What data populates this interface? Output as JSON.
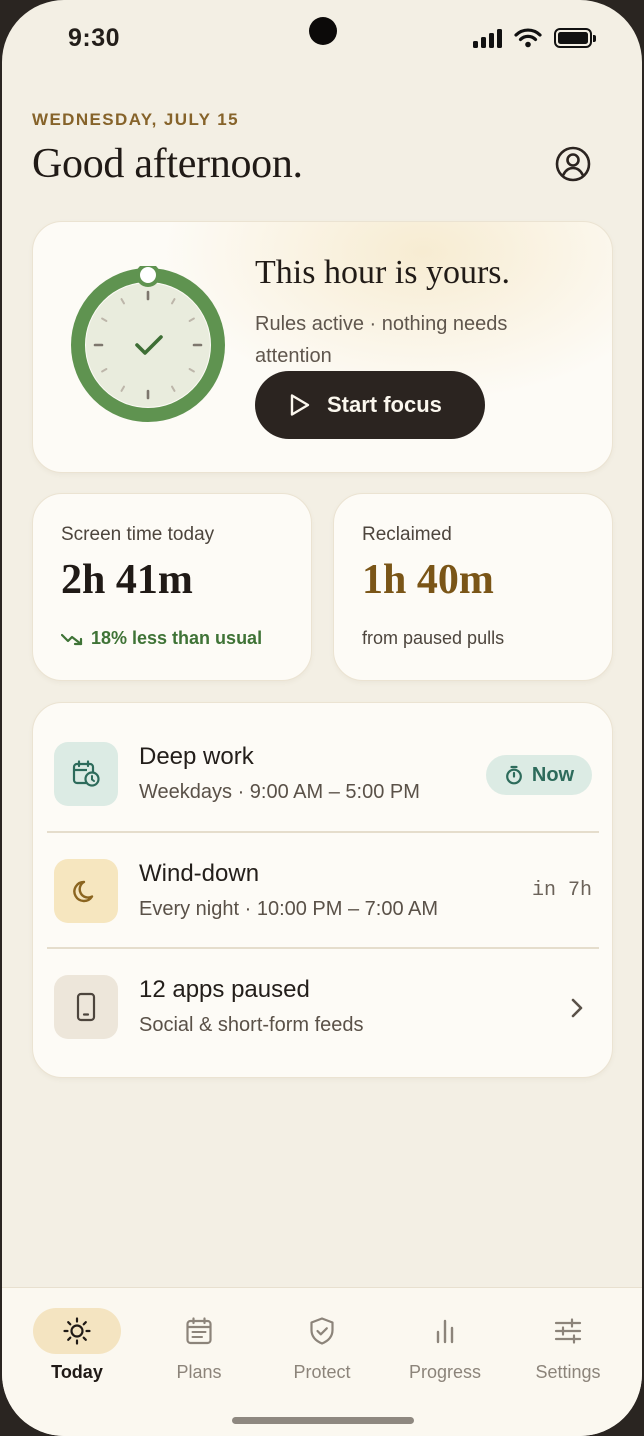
{
  "status_bar": {
    "time": "9:30"
  },
  "header": {
    "date": "WEDNESDAY, JULY 15",
    "greeting": "Good afternoon."
  },
  "hero": {
    "title": "This hour is yours.",
    "subtitle": "Rules active · nothing needs attention",
    "button_label": "Start focus"
  },
  "stats": {
    "screen_time": {
      "label": "Screen time today",
      "value": "2h 41m",
      "note": "18% less than usual"
    },
    "reclaimed": {
      "label": "Reclaimed",
      "value": "1h 40m",
      "note": "from paused pulls"
    }
  },
  "rules": [
    {
      "title": "Deep work",
      "subtitle": "Weekdays · 9:00 AM – 5:00 PM",
      "badge": "Now",
      "icon": "calendar-clock-icon"
    },
    {
      "title": "Wind-down",
      "subtitle": "Every night · 10:00 PM – 7:00 AM",
      "trailing": "in 7h",
      "icon": "moon-icon"
    },
    {
      "title": "12 apps paused",
      "subtitle": "Social & short-form feeds",
      "icon": "phone-icon"
    }
  ],
  "tabs": [
    {
      "label": "Today",
      "icon": "sun-icon",
      "active": true
    },
    {
      "label": "Plans",
      "icon": "calendar-icon"
    },
    {
      "label": "Protect",
      "icon": "shield-check-icon"
    },
    {
      "label": "Progress",
      "icon": "bar-chart-icon"
    },
    {
      "label": "Settings",
      "icon": "sliders-icon"
    }
  ],
  "colors": {
    "background": "#f3efe4",
    "accent_gold": "#86632a",
    "accent_green": "#5f9350",
    "button_dark": "#2b2420",
    "badge_teal": "#dcebe4"
  }
}
